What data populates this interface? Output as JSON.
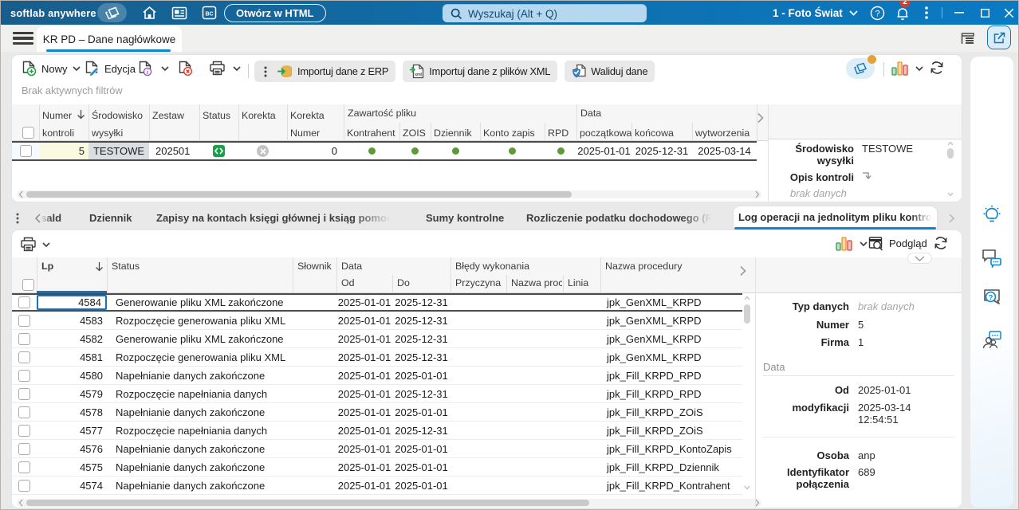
{
  "titlebar": {
    "app_name": "softlab anywhere",
    "open_html": "Otwórz w HTML",
    "search_placeholder": "Wyszukaj (Alt + Q)",
    "company": "1 - Foto Świat",
    "notification_count": "2"
  },
  "tabstrip": {
    "document_tab": "KR PD – Dane nagłówkowe"
  },
  "toolbar": {
    "new": "Nowy",
    "edit": "Edycja",
    "import_erp": "Importuj dane z ERP",
    "import_xml": "Importuj dane z plików XML",
    "validate": "Waliduj dane"
  },
  "filter_status": "Brak aktywnych filtrów",
  "header_table": {
    "columns": {
      "numer": "Numer kontroli",
      "srodowisko": "Środowisko wysyłki",
      "zestaw": "Zestaw",
      "status": "Status",
      "korekta": "Korekta",
      "korekta_numer": "Korekta Numer",
      "group_content": "Zawartość pliku",
      "kontrahent": "Kontrahent",
      "zois": "ZOIS",
      "dziennik": "Dziennik",
      "konto_zapis": "Konto zapis",
      "rpd": "RPD",
      "group_date": "Data",
      "poczatkowa": "początkowa",
      "koncowa": "końcowa",
      "wytworzenia": "wytworzenia"
    },
    "row": {
      "numer": "5",
      "srodowisko": "TESTOWE",
      "zestaw": "202501",
      "korekta_numer": "0",
      "poczatkowa": "2025-01-01",
      "koncowa": "2025-12-31",
      "wytworzenia": "2025-03-14"
    }
  },
  "header_detail": {
    "srodowisko_label": "Środowisko wysyłki",
    "srodowisko_value": "TESTOWE",
    "opis_label": "Opis kontroli",
    "empty_value": "brak danych"
  },
  "subtabs": {
    "items": [
      {
        "label": "sald"
      },
      {
        "label": "Dziennik"
      },
      {
        "label": "Zapisy na kontach księgi głównej i ksiąg pomocniczych"
      },
      {
        "label": "Sumy kontrolne"
      },
      {
        "label": "Rozliczenie podatku dochodowego (RPD)"
      },
      {
        "label": "Log operacji na jednolitym pliku kontrolnym"
      }
    ],
    "active_index": 5
  },
  "log_toolbar": {
    "preview": "Podgląd"
  },
  "log_table": {
    "columns": {
      "lp": "Lp",
      "status": "Status",
      "slownik": "Słownik",
      "group_data": "Data",
      "od": "Od",
      "do": "Do",
      "group_errors": "Błędy wykonania",
      "przyczyna": "Przyczyna",
      "nazwa_proc": "Nazwa proc",
      "linia": "Linia",
      "nazwa_procedury": "Nazwa procedury"
    },
    "rows": [
      {
        "lp": "4584",
        "status": "Generowanie pliku XML zakończone",
        "od": "2025-01-01",
        "do": "2025-12-31",
        "proc": "jpk_GenXML_KRPD"
      },
      {
        "lp": "4583",
        "status": "Rozpoczęcie generowania pliku XML",
        "od": "2025-01-01",
        "do": "2025-12-31",
        "proc": "jpk_GenXML_KRPD"
      },
      {
        "lp": "4582",
        "status": "Generowanie pliku XML zakończone",
        "od": "2025-01-01",
        "do": "2025-12-31",
        "proc": "jpk_GenXML_KRPD"
      },
      {
        "lp": "4581",
        "status": "Rozpoczęcie generowania pliku XML",
        "od": "2025-01-01",
        "do": "2025-12-31",
        "proc": "jpk_GenXML_KRPD"
      },
      {
        "lp": "4580",
        "status": "Napełnianie danych zakończone",
        "od": "2025-01-01",
        "do": "2025-01-01",
        "proc": "jpk_Fill_KRPD_RPD"
      },
      {
        "lp": "4579",
        "status": "Rozpoczęcie napełniania danych",
        "od": "2025-01-01",
        "do": "2025-12-31",
        "proc": "jpk_Fill_KRPD_RPD"
      },
      {
        "lp": "4578",
        "status": "Napełnianie danych zakończone",
        "od": "2025-01-01",
        "do": "2025-01-01",
        "proc": "jpk_Fill_KRPD_ZOiS"
      },
      {
        "lp": "4577",
        "status": "Rozpoczęcie napełniania danych",
        "od": "2025-01-01",
        "do": "2025-12-31",
        "proc": "jpk_Fill_KRPD_ZOiS"
      },
      {
        "lp": "4576",
        "status": "Napełnianie danych zakończone",
        "od": "2025-01-01",
        "do": "2025-01-01",
        "proc": "jpk_Fill_KRPD_KontoZapis"
      },
      {
        "lp": "4575",
        "status": "Napełnianie danych zakończone",
        "od": "2025-01-01",
        "do": "2025-01-01",
        "proc": "jpk_Fill_KRPD_Dziennik"
      },
      {
        "lp": "4574",
        "status": "Napełnianie danych zakończone",
        "od": "2025-01-01",
        "do": "2025-01-01",
        "proc": "jpk_Fill_KRPD_Kontrahent"
      }
    ]
  },
  "log_detail": {
    "typ_danych_label": "Typ danych",
    "typ_danych_value": "brak danych",
    "numer_label": "Numer",
    "numer_value": "5",
    "firma_label": "Firma",
    "firma_value": "1",
    "data_section": "Data",
    "od_label": "Od",
    "od_value": "2025-01-01",
    "modyfikacji_label": "modyfikacji",
    "modyfikacji_date": "2025-03-14",
    "modyfikacji_time": "12:54:51",
    "osoba_label": "Osoba",
    "osoba_value": "anp",
    "identyfikator_label": "Identyfikator połączenia",
    "identyfikator_value": "689"
  },
  "colors": {
    "accent_blue": "#1087cb",
    "titlebar_left": "#185e8c",
    "titlebar_right": "#0a7ac3",
    "status_green": "#17a24a",
    "dot_green": "#5d9b35",
    "badge_red": "#d63d2e"
  }
}
